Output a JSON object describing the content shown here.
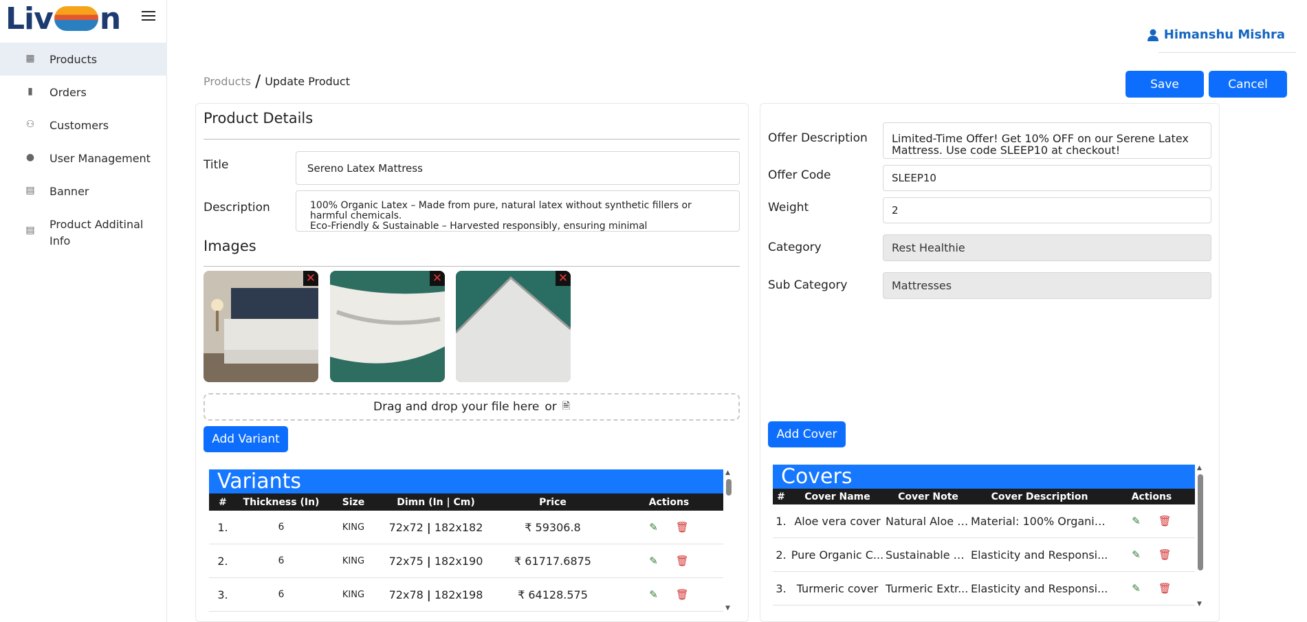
{
  "app": {
    "logo_text_a": "Liv",
    "logo_text_b": "n"
  },
  "sidebar": {
    "items": [
      {
        "label": "Products",
        "icon": "calendar-icon"
      },
      {
        "label": "Orders",
        "icon": "clipboard-icon"
      },
      {
        "label": "Customers",
        "icon": "users-icon"
      },
      {
        "label": "User Management",
        "icon": "user-icon"
      },
      {
        "label": "Banner",
        "icon": "images-icon"
      },
      {
        "label": "Product Additinal Info",
        "icon": "images-icon"
      }
    ]
  },
  "header": {
    "user_name": "Himanshu Mishra"
  },
  "breadcrumb": {
    "parent": "Products",
    "current": "Update Product"
  },
  "actions": {
    "save": "Save",
    "cancel": "Cancel"
  },
  "product": {
    "section_title": "Product Details",
    "title_label": "Title",
    "title_value": "Sereno Latex Mattress",
    "description_label": "Description",
    "description_value": "100% Organic Latex – Made from pure, natural latex without synthetic fillers or harmful chemicals.\nEco-Friendly & Sustainable – Harvested responsibly, ensuring minimal",
    "images_title": "Images",
    "dropzone_text": "Drag and drop your file here",
    "dropzone_or": "or",
    "add_variant": "Add Variant"
  },
  "variants": {
    "title": "Variants",
    "columns": [
      "#",
      "Thickness (In)",
      "Size",
      "Dimn (In | Cm)",
      "Price",
      "Actions"
    ],
    "rows": [
      {
        "n": "1.",
        "thickness": "6",
        "size": "KING",
        "dimn_in": "72x72",
        "dimn_cm": "182x182",
        "price": "₹ 59306.8"
      },
      {
        "n": "2.",
        "thickness": "6",
        "size": "KING",
        "dimn_in": "72x75",
        "dimn_cm": "182x190",
        "price": "₹ 61717.6875"
      },
      {
        "n": "3.",
        "thickness": "6",
        "size": "KING",
        "dimn_in": "72x78",
        "dimn_cm": "182x198",
        "price": "₹ 64128.575"
      }
    ]
  },
  "offer": {
    "description_label": "Offer Description",
    "description_value": "Limited-Time Offer! Get 10% OFF on our Serene Latex Mattress. Use code SLEEP10 at checkout!",
    "code_label": "Offer Code",
    "code_value": "SLEEP10",
    "weight_label": "Weight",
    "weight_value": "2",
    "category_label": "Category",
    "category_value": "Rest Healthie",
    "subcategory_label": "Sub Category",
    "subcategory_value": "Mattresses",
    "add_cover": "Add Cover"
  },
  "covers": {
    "title": "Covers",
    "columns": [
      "#",
      "Cover Name",
      "Cover Note",
      "Cover Description",
      "Actions"
    ],
    "rows": [
      {
        "n": "1.",
        "name": "Aloe vera cover",
        "note": "Natural Aloe v...",
        "desc": "Material: 100% Organic ..."
      },
      {
        "n": "2.",
        "name": "Pure Organic C...",
        "note": "Sustainable O...",
        "desc": "Elasticity and Responsi..."
      },
      {
        "n": "3.",
        "name": "Turmeric cover",
        "note": "Turmeric Extr...",
        "desc": "Elasticity and Responsi..."
      }
    ]
  }
}
